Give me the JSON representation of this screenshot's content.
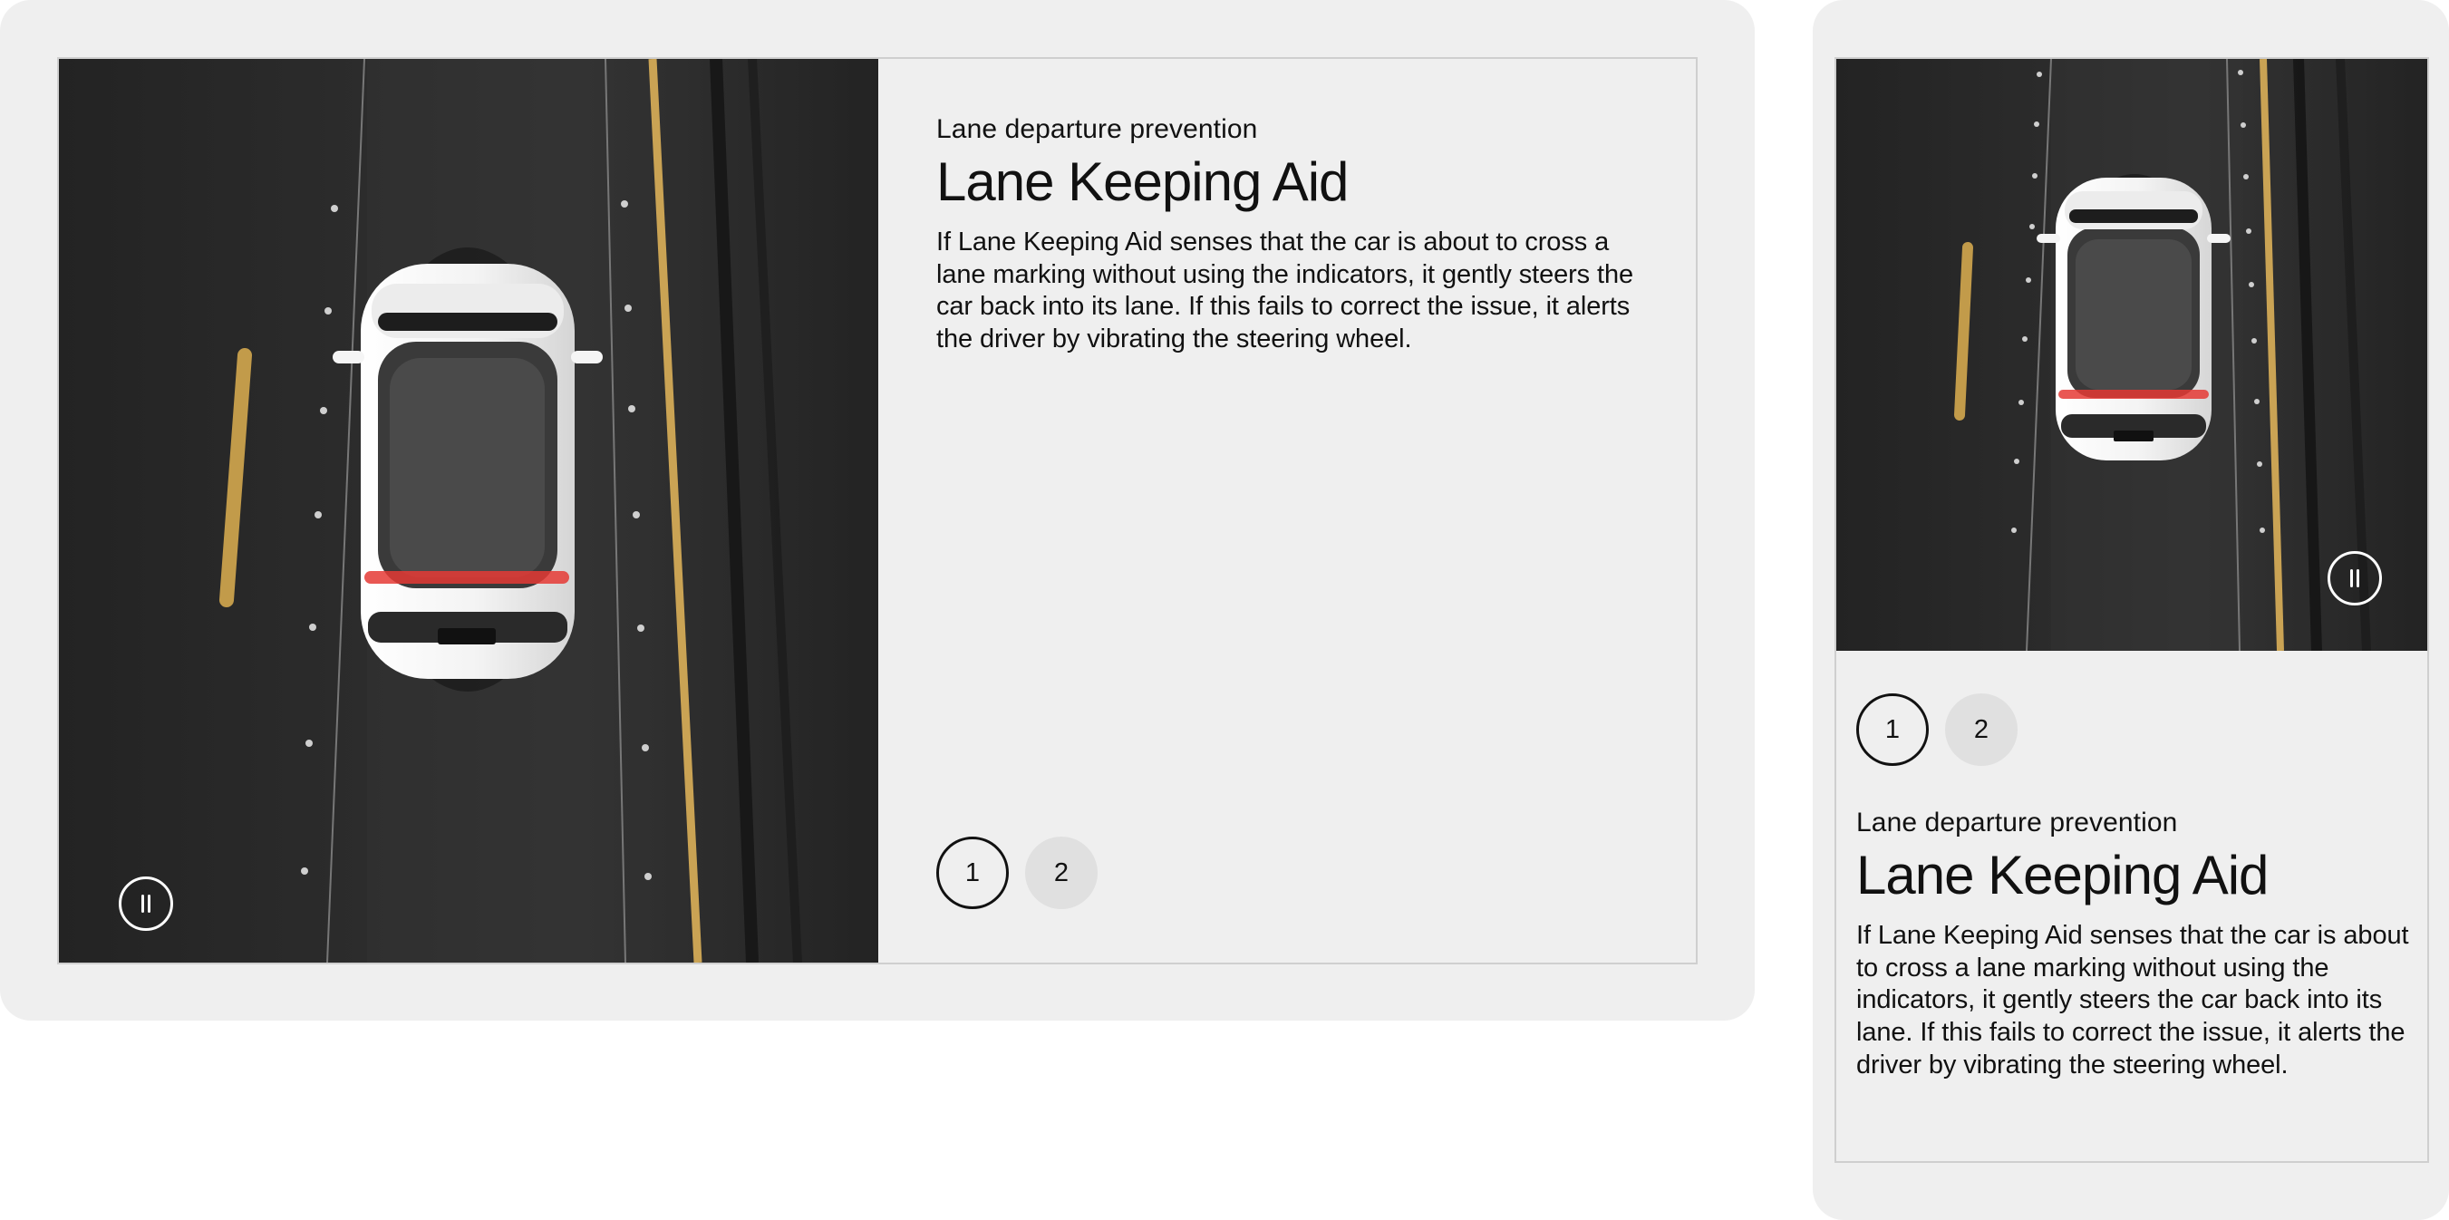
{
  "desktop": {
    "eyebrow": "Lane departure prevention",
    "title": "Lane Keeping Aid",
    "description": "If Lane Keeping Aid senses that the car is about to cross a lane marking without using the indicators, it gently steers the car back into its lane. If this fails to correct the issue, it alerts the driver by vibrating the steering wheel.",
    "pagination": [
      {
        "label": "1",
        "active": true
      },
      {
        "label": "2",
        "active": false
      }
    ]
  },
  "mobile": {
    "eyebrow": "Lane departure prevention",
    "title": "Lane Keeping Aid",
    "description": "If Lane Keeping Aid senses that the car is about to cross a lane marking without using the indicators, it gently steers the car back into its lane. If this fails to correct the issue, it alerts the driver by vibrating the steering wheel.",
    "pagination": [
      {
        "label": "1",
        "active": true
      },
      {
        "label": "2",
        "active": false
      }
    ]
  },
  "icons": {
    "pause": "pause-icon"
  },
  "colors": {
    "frame_background": "#efefef",
    "card_border": "#cfcfcf",
    "road": "#2f2f2f",
    "lane_yellow": "#c8a04c",
    "text": "#111111",
    "inactive_page": "#e0e0e0"
  }
}
